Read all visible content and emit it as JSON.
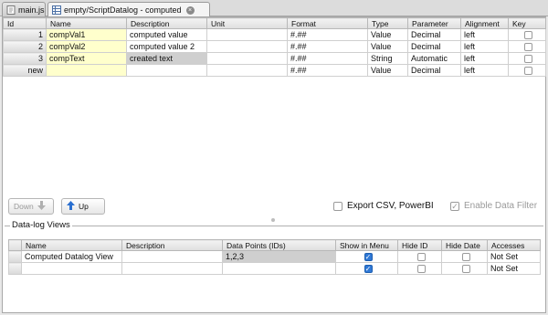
{
  "tabs": [
    {
      "label": "main.js",
      "icon": "js-file-icon"
    },
    {
      "label": "empty/ScriptDatalog - computed",
      "icon": "datalog-icon"
    }
  ],
  "columns": [
    "Id",
    "Name",
    "Description",
    "Unit",
    "Format",
    "Type",
    "Parameter",
    "Alignment",
    "Key"
  ],
  "rows": [
    {
      "id": "1",
      "name": "compVal1",
      "description": "computed value",
      "unit": "",
      "format": "#.##",
      "type": "Value",
      "parameter": "Decimal",
      "alignment": "left",
      "key": false
    },
    {
      "id": "2",
      "name": "compVal2",
      "description": "computed value 2",
      "unit": "",
      "format": "#.##",
      "type": "Value",
      "parameter": "Decimal",
      "alignment": "left",
      "key": false
    },
    {
      "id": "3",
      "name": "compText",
      "description": "created text",
      "unit": "",
      "format": "#.##",
      "type": "String",
      "parameter": "Automatic",
      "alignment": "left",
      "key": false
    },
    {
      "id": "new",
      "name": "",
      "description": "",
      "unit": "",
      "format": "#.##",
      "type": "Value",
      "parameter": "Decimal",
      "alignment": "left",
      "key": false
    }
  ],
  "toolbar": {
    "down_label": "Down",
    "up_label": "Up",
    "export_label": "Export CSV, PowerBI",
    "filter_label": "Enable Data Filter"
  },
  "views": {
    "legend": "Data-log Views",
    "columns": [
      "Name",
      "Description",
      "Data Points (IDs)",
      "Show in Menu",
      "Hide ID",
      "Hide Date",
      "Accesses"
    ],
    "rows": [
      {
        "name": "Computed Datalog View",
        "description": "",
        "points": "1,2,3",
        "show_in_menu": true,
        "hide_id": false,
        "hide_date": false,
        "accesses": "Not Set"
      },
      {
        "name": "",
        "description": "",
        "points": "",
        "show_in_menu": true,
        "hide_id": false,
        "hide_date": false,
        "accesses": "Not Set"
      }
    ]
  },
  "colors": {
    "name_bg": "#ffffcc",
    "selected_bg": "#cfcfcf",
    "check_blue": "#2f78d6",
    "up_arrow_blue": "#2a6fd0"
  }
}
